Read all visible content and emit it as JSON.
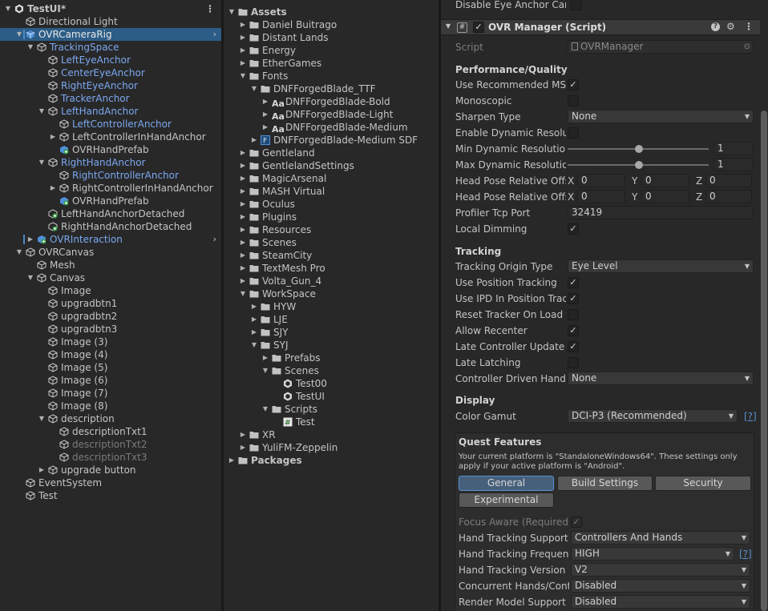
{
  "hierarchy": {
    "items": [
      {
        "label": "TestUI*",
        "depth": 0,
        "fold": "open",
        "icon": "unity-scene-icon",
        "kind": "scene",
        "menu": "⋮"
      },
      {
        "label": "Directional Light",
        "depth": 1,
        "fold": "",
        "icon": "gameobject-icon",
        "kind": "normal"
      },
      {
        "label": "OVRCameraRig",
        "depth": 1,
        "fold": "open",
        "icon": "prefab-icon",
        "kind": "selected",
        "chev": "›"
      },
      {
        "label": "TrackingSpace",
        "depth": 2,
        "fold": "open",
        "icon": "gameobject-icon",
        "kind": "prefab"
      },
      {
        "label": "LeftEyeAnchor",
        "depth": 3,
        "fold": "",
        "icon": "gameobject-icon",
        "kind": "prefab"
      },
      {
        "label": "CenterEyeAnchor",
        "depth": 3,
        "fold": "",
        "icon": "gameobject-icon",
        "kind": "prefab"
      },
      {
        "label": "RightEyeAnchor",
        "depth": 3,
        "fold": "",
        "icon": "gameobject-icon",
        "kind": "prefab"
      },
      {
        "label": "TrackerAnchor",
        "depth": 3,
        "fold": "",
        "icon": "gameobject-icon",
        "kind": "prefab"
      },
      {
        "label": "LeftHandAnchor",
        "depth": 3,
        "fold": "open",
        "icon": "gameobject-icon",
        "kind": "prefab"
      },
      {
        "label": "LeftControllerAnchor",
        "depth": 4,
        "fold": "",
        "icon": "gameobject-icon",
        "kind": "prefab"
      },
      {
        "label": "LeftControllerInHandAnchor",
        "depth": 4,
        "fold": "closed",
        "icon": "gameobject-icon",
        "kind": "normal"
      },
      {
        "label": "OVRHandPrefab",
        "depth": 4,
        "fold": "",
        "icon": "added-prefab-icon",
        "kind": "normal"
      },
      {
        "label": "RightHandAnchor",
        "depth": 3,
        "fold": "open",
        "icon": "gameobject-icon",
        "kind": "prefab"
      },
      {
        "label": "RightControllerAnchor",
        "depth": 4,
        "fold": "",
        "icon": "gameobject-icon",
        "kind": "prefab"
      },
      {
        "label": "RightControllerInHandAnchor",
        "depth": 4,
        "fold": "closed",
        "icon": "gameobject-icon",
        "kind": "normal"
      },
      {
        "label": "OVRHandPrefab",
        "depth": 4,
        "fold": "",
        "icon": "added-prefab-icon",
        "kind": "normal"
      },
      {
        "label": "LeftHandAnchorDetached",
        "depth": 3,
        "fold": "",
        "icon": "added-gameobject-icon",
        "kind": "normal"
      },
      {
        "label": "RightHandAnchorDetached",
        "depth": 3,
        "fold": "",
        "icon": "added-gameobject-icon",
        "kind": "normal"
      },
      {
        "label": "OVRInteraction",
        "depth": 2,
        "fold": "closed",
        "icon": "added-prefab-icon",
        "kind": "prefab",
        "chev": "›"
      },
      {
        "label": "OVRCanvas",
        "depth": 1,
        "fold": "open",
        "icon": "gameobject-icon",
        "kind": "normal"
      },
      {
        "label": "Mesh",
        "depth": 2,
        "fold": "",
        "icon": "gameobject-icon",
        "kind": "normal"
      },
      {
        "label": "Canvas",
        "depth": 2,
        "fold": "open",
        "icon": "gameobject-icon",
        "kind": "normal"
      },
      {
        "label": "Image",
        "depth": 3,
        "fold": "",
        "icon": "gameobject-icon",
        "kind": "normal"
      },
      {
        "label": "upgradbtn1",
        "depth": 3,
        "fold": "",
        "icon": "gameobject-icon",
        "kind": "normal"
      },
      {
        "label": "upgradbtn2",
        "depth": 3,
        "fold": "",
        "icon": "gameobject-icon",
        "kind": "normal"
      },
      {
        "label": "upgradbtn3",
        "depth": 3,
        "fold": "",
        "icon": "gameobject-icon",
        "kind": "normal"
      },
      {
        "label": "Image (3)",
        "depth": 3,
        "fold": "",
        "icon": "gameobject-icon",
        "kind": "normal"
      },
      {
        "label": "Image (4)",
        "depth": 3,
        "fold": "",
        "icon": "gameobject-icon",
        "kind": "normal"
      },
      {
        "label": "Image (5)",
        "depth": 3,
        "fold": "",
        "icon": "gameobject-icon",
        "kind": "normal"
      },
      {
        "label": "Image (6)",
        "depth": 3,
        "fold": "",
        "icon": "gameobject-icon",
        "kind": "normal"
      },
      {
        "label": "Image (7)",
        "depth": 3,
        "fold": "",
        "icon": "gameobject-icon",
        "kind": "normal"
      },
      {
        "label": "Image (8)",
        "depth": 3,
        "fold": "",
        "icon": "gameobject-icon",
        "kind": "normal"
      },
      {
        "label": "description",
        "depth": 3,
        "fold": "open",
        "icon": "gameobject-icon",
        "kind": "normal"
      },
      {
        "label": "descriptionTxt1",
        "depth": 4,
        "fold": "",
        "icon": "gameobject-icon",
        "kind": "normal"
      },
      {
        "label": "descriptionTxt2",
        "depth": 4,
        "fold": "",
        "icon": "gameobject-icon",
        "kind": "dim"
      },
      {
        "label": "descriptionTxt3",
        "depth": 4,
        "fold": "",
        "icon": "gameobject-icon",
        "kind": "dim"
      },
      {
        "label": "upgrade button",
        "depth": 3,
        "fold": "closed",
        "icon": "gameobject-icon",
        "kind": "normal"
      },
      {
        "label": "EventSystem",
        "depth": 1,
        "fold": "",
        "icon": "gameobject-icon",
        "kind": "normal"
      },
      {
        "label": "Test",
        "depth": 1,
        "fold": "",
        "icon": "gameobject-icon",
        "kind": "normal"
      }
    ]
  },
  "project": {
    "items": [
      {
        "label": "Assets",
        "depth": 0,
        "fold": "open",
        "icon": "folder-icon",
        "bold": true
      },
      {
        "label": "Daniel Buitrago",
        "depth": 1,
        "fold": "closed",
        "icon": "folder-icon"
      },
      {
        "label": "Distant Lands",
        "depth": 1,
        "fold": "closed",
        "icon": "folder-icon"
      },
      {
        "label": "Energy",
        "depth": 1,
        "fold": "closed",
        "icon": "folder-icon"
      },
      {
        "label": "EtherGames",
        "depth": 1,
        "fold": "closed",
        "icon": "folder-icon"
      },
      {
        "label": "Fonts",
        "depth": 1,
        "fold": "open",
        "icon": "folder-icon"
      },
      {
        "label": "DNFForgedBlade_TTF",
        "depth": 2,
        "fold": "open",
        "icon": "folder-icon"
      },
      {
        "label": "DNFForgedBlade-Bold",
        "depth": 3,
        "fold": "closed",
        "icon": "font-icon"
      },
      {
        "label": "DNFForgedBlade-Light",
        "depth": 3,
        "fold": "closed",
        "icon": "font-icon"
      },
      {
        "label": "DNFForgedBlade-Medium",
        "depth": 3,
        "fold": "closed",
        "icon": "font-icon"
      },
      {
        "label": "DNFForgedBlade-Medium SDF",
        "depth": 2,
        "fold": "closed",
        "icon": "font-asset-icon"
      },
      {
        "label": "Gentleland",
        "depth": 1,
        "fold": "closed",
        "icon": "folder-icon"
      },
      {
        "label": "GentlelandSettings",
        "depth": 1,
        "fold": "closed",
        "icon": "folder-icon"
      },
      {
        "label": "MagicArsenal",
        "depth": 1,
        "fold": "closed",
        "icon": "folder-icon"
      },
      {
        "label": "MASH Virtual",
        "depth": 1,
        "fold": "closed",
        "icon": "folder-icon"
      },
      {
        "label": "Oculus",
        "depth": 1,
        "fold": "closed",
        "icon": "folder-icon"
      },
      {
        "label": "Plugins",
        "depth": 1,
        "fold": "closed",
        "icon": "folder-icon"
      },
      {
        "label": "Resources",
        "depth": 1,
        "fold": "closed",
        "icon": "folder-icon"
      },
      {
        "label": "Scenes",
        "depth": 1,
        "fold": "closed",
        "icon": "folder-icon"
      },
      {
        "label": "SteamCity",
        "depth": 1,
        "fold": "closed",
        "icon": "folder-icon"
      },
      {
        "label": "TextMesh Pro",
        "depth": 1,
        "fold": "closed",
        "icon": "folder-icon"
      },
      {
        "label": "Volta_Gun_4",
        "depth": 1,
        "fold": "closed",
        "icon": "folder-icon"
      },
      {
        "label": "WorkSpace",
        "depth": 1,
        "fold": "open",
        "icon": "folder-icon"
      },
      {
        "label": "HYW",
        "depth": 2,
        "fold": "closed",
        "icon": "folder-icon"
      },
      {
        "label": "LJE",
        "depth": 2,
        "fold": "closed",
        "icon": "folder-icon"
      },
      {
        "label": "SJY",
        "depth": 2,
        "fold": "closed",
        "icon": "folder-icon"
      },
      {
        "label": "SYJ",
        "depth": 2,
        "fold": "open",
        "icon": "folder-icon"
      },
      {
        "label": "Prefabs",
        "depth": 3,
        "fold": "closed",
        "icon": "folder-icon"
      },
      {
        "label": "Scenes",
        "depth": 3,
        "fold": "open",
        "icon": "folder-icon"
      },
      {
        "label": "Test00",
        "depth": 4,
        "fold": "",
        "icon": "unity-scene-icon"
      },
      {
        "label": "TestUI",
        "depth": 4,
        "fold": "",
        "icon": "unity-scene-icon"
      },
      {
        "label": "Scripts",
        "depth": 3,
        "fold": "open",
        "icon": "folder-icon"
      },
      {
        "label": "Test",
        "depth": 4,
        "fold": "",
        "icon": "csharp-script-icon"
      },
      {
        "label": "XR",
        "depth": 1,
        "fold": "closed",
        "icon": "folder-icon"
      },
      {
        "label": "YuliFM-Zeppelin",
        "depth": 1,
        "fold": "closed",
        "icon": "folder-icon"
      },
      {
        "label": "Packages",
        "depth": 0,
        "fold": "closed",
        "icon": "folder-icon",
        "bold": true
      }
    ]
  },
  "inspector": {
    "top_cut_label": "Disable Eye Anchor Came",
    "component_title": "OVR Manager (Script)",
    "script_label": "Script",
    "script_value": "OVRManager",
    "sections": {
      "performance": "Performance/Quality",
      "tracking": "Tracking",
      "display": "Display",
      "quest": "Quest Features"
    },
    "perf": {
      "use_msaa": "Use Recommended MSA",
      "monoscopic": "Monoscopic",
      "sharpen": "Sharpen Type",
      "sharpen_value": "None",
      "enable_dyn": "Enable Dynamic Resolut",
      "min_dyn": "Min Dynamic Resolution",
      "min_dyn_value": "1",
      "max_dyn": "Max Dynamic Resolution",
      "max_dyn_value": "1",
      "head_pose_1": "Head Pose Relative Offs",
      "head_pose_2": "Head Pose Relative Offs",
      "axis_x": "X",
      "axis_y": "Y",
      "axis_z": "Z",
      "zero": "0",
      "profiler": "Profiler Tcp Port",
      "profiler_value": "32419",
      "local_dimming": "Local Dimming"
    },
    "tracking": {
      "origin": "Tracking Origin Type",
      "origin_value": "Eye Level",
      "use_pos": "Use Position Tracking",
      "use_ipd": "Use IPD In Position Track",
      "reset_tracker": "Reset Tracker On Load",
      "allow_recenter": "Allow Recenter",
      "late_controller": "Late Controller Update",
      "late_latching": "Late Latching",
      "controller_driven": "Controller Driven Hand P",
      "controller_driven_value": "None"
    },
    "display": {
      "gamut": "Color Gamut",
      "gamut_value": "DCI-P3 (Recommended)",
      "help": "[?]"
    },
    "quest": {
      "platform_note": "Your current platform is \"StandaloneWindows64\". These settings only apply if your active platform is \"Android\".",
      "tab_general": "General",
      "tab_build": "Build Settings",
      "tab_security": "Security",
      "tab_experimental": "Experimental",
      "focus_aware": "Focus Aware (Required)",
      "hand_support": "Hand Tracking Support",
      "hand_support_value": "Controllers And Hands",
      "hand_freq": "Hand Tracking Frequenc",
      "hand_freq_value": "HIGH",
      "hand_version": "Hand Tracking Version",
      "hand_version_value": "V2",
      "concurrent": "Concurrent Hands/Contr",
      "concurrent_value": "Disabled",
      "render_model": "Render Model Support",
      "render_model_value": "Disabled",
      "help": "[?]"
    },
    "checks": {
      "check": "✓",
      "checked": [
        true,
        false,
        false,
        true,
        true,
        true,
        false,
        true,
        true,
        false,
        true
      ]
    },
    "menu_glyph": "⋮",
    "help_glyph": "?",
    "hash_glyph": "#"
  },
  "colors": {
    "selection": "#2c5d87",
    "prefab_text": "#7ba8f0",
    "accent_link": "#5a8fd0"
  }
}
